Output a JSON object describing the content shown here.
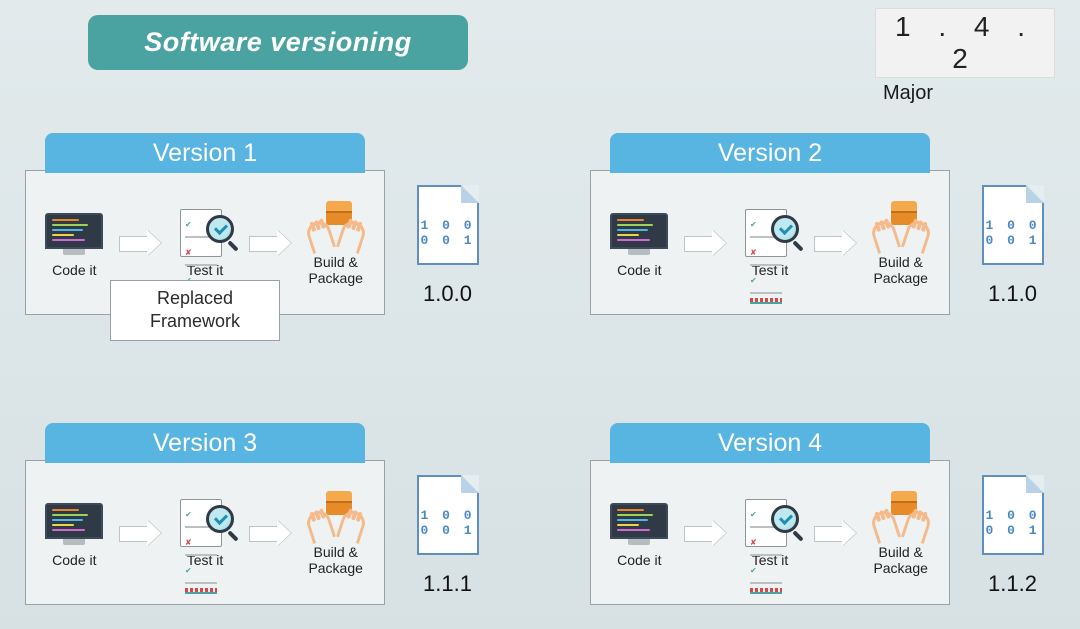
{
  "title": "Software versioning",
  "legend": {
    "digits": "1 . 4 . 2",
    "caption": "Major"
  },
  "cards": {
    "v1": {
      "header": "Version 1",
      "stages": {
        "code": "Code it",
        "test": "Test it",
        "build": "Build &\nPackage"
      },
      "note": "Replaced Framework",
      "file_bits": "1 0 0\n0 0 1",
      "file_version": "1.0.0"
    },
    "v2": {
      "header": "Version 2",
      "stages": {
        "code": "Code it",
        "test": "Test it",
        "build": "Build &\nPackage"
      },
      "file_bits": "1 0 0\n0 0 1",
      "file_version": "1.1.0"
    },
    "v3": {
      "header": "Version 3",
      "stages": {
        "code": "Code it",
        "test": "Test it",
        "build": "Build &\nPackage"
      },
      "file_bits": "1 0 0\n0 0 1",
      "file_version": "1.1.1"
    },
    "v4": {
      "header": "Version 4",
      "stages": {
        "code": "Code it",
        "test": "Test it",
        "build": "Build &\nPackage"
      },
      "file_bits": "1 0 0\n0 0 1",
      "file_version": "1.1.2"
    }
  },
  "icons": {
    "monitor": "monitor-code-icon",
    "test": "magnifier-check-icon",
    "build": "hands-box-icon",
    "arrow": "arrow-right-icon",
    "file": "binary-file-icon"
  }
}
